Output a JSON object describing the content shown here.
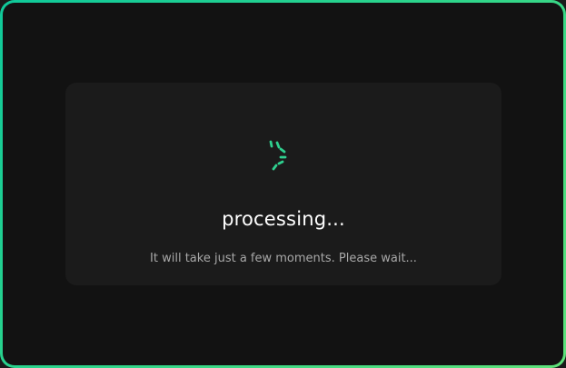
{
  "loader": {
    "title": "processing...",
    "message": "It will take just a few moments. Please wait..."
  },
  "colors": {
    "accent": "#2fd08f",
    "frame_start": "#0fc99a",
    "frame_end": "#5fe27a",
    "background": "#121212",
    "card": "#1b1b1b"
  },
  "icons": {
    "spinner": "loading-spinner-icon"
  }
}
